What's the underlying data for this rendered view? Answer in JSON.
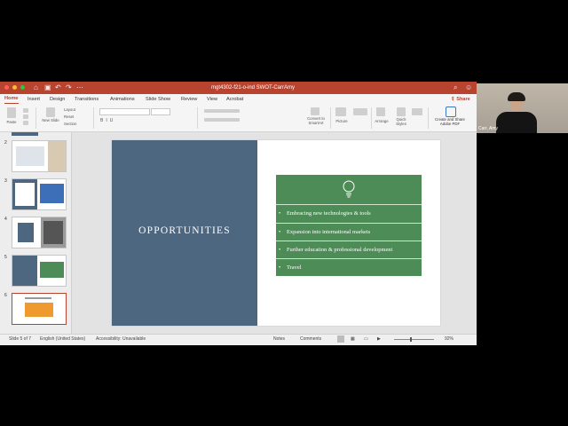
{
  "window": {
    "title": "mgt4302-f21-o-ind SWOT-CarrAmy",
    "colors": {
      "titlebar": "#b8432f",
      "slide_blue": "#4e6781",
      "slide_green": "#4d8c56"
    },
    "titlebar_icons": [
      "home-icon",
      "save-icon",
      "undo-icon",
      "redo-icon",
      "search-icon",
      "smiley-icon"
    ]
  },
  "ribbon_tabs": [
    "Home",
    "Insert",
    "Design",
    "Transitions",
    "Animations",
    "Slide Show",
    "Review",
    "View",
    "Acrobat"
  ],
  "active_tab": "Home",
  "share_label": "Share",
  "ribbon": {
    "paste": "Paste",
    "new_slide": "New Slide",
    "layout": "Layout",
    "reset": "Reset",
    "section": "Section",
    "convert": "Convert to SmartArt",
    "picture": "Picture",
    "arrange": "Arrange",
    "quick_styles": "Quick Styles",
    "create_share": "Create and Share Adobe PDF"
  },
  "thumbnails": [
    {
      "num": "2"
    },
    {
      "num": "3"
    },
    {
      "num": "4"
    },
    {
      "num": "5"
    },
    {
      "num": "6",
      "selected": true
    }
  ],
  "slide": {
    "title": "OPPORTUNITIES",
    "icon": "lightbulb-icon",
    "items": [
      "Embracing new technologies & tools",
      "Expansion into international markets",
      "Further education & professional development",
      "Travel"
    ]
  },
  "status": {
    "slide_of": "Slide 5 of 7",
    "language": "English (United States)",
    "accessibility": "Accessibility: Unavailable",
    "notes": "Notes",
    "comments": "Comments",
    "zoom": "92%"
  },
  "webcam": {
    "name": "Carr, Amy"
  }
}
